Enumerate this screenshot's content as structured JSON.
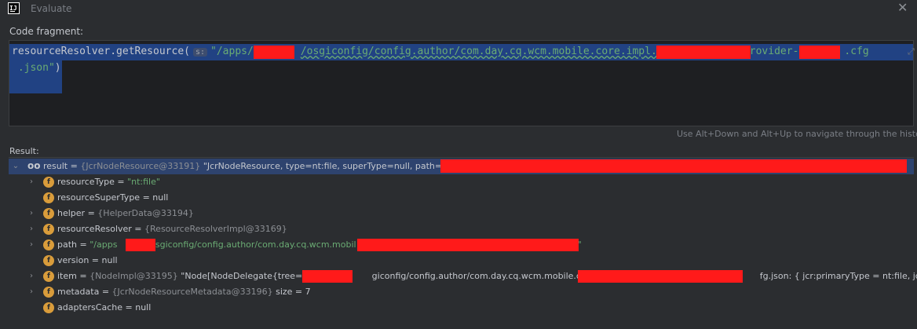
{
  "window": {
    "title": "Evaluate",
    "close_label": "✕",
    "app_icon_text": "IJ"
  },
  "code": {
    "label": "Code fragment:",
    "line1_pre": "resourceResolver.getResource(",
    "param_hint": "s:",
    "line1_str_a": "\"/apps/",
    "line1_str_b": "/osgiconfig/config.author/com.day.cq.wcm.mobile.core.impl.",
    "line1_str_c": "rovider-",
    "line1_str_d": ".cfg",
    "line2_str": " .json\"",
    "line2_post": ")"
  },
  "nav_hint": "Use Alt+Down and Alt+Up to navigate through the history",
  "result": {
    "label": "Result:",
    "root": {
      "name": "result",
      "ref": "{JcrNodeResource@33191}",
      "value": "\"JcrNodeResource, type=nt:file, superType=null, path=/apps"
    },
    "fields": [
      {
        "name": "resourceType",
        "eq": " = ",
        "ref": "",
        "value": "\"nt:file\"",
        "value_is_string": true,
        "expandable": true
      },
      {
        "name": "resourceSuperType",
        "eq": " = ",
        "ref": "",
        "value": "null",
        "value_is_string": false,
        "expandable": false
      },
      {
        "name": "helper",
        "eq": " = ",
        "ref": "{HelperData@33194}",
        "value": "",
        "value_is_string": false,
        "expandable": true
      },
      {
        "name": "resourceResolver",
        "eq": " = ",
        "ref": "{ResourceResolverImpl@33169}",
        "value": "",
        "value_is_string": false,
        "expandable": true
      },
      {
        "name": "path",
        "eq": " = ",
        "ref": "",
        "value": "\"/apps",
        "value_is_string": true,
        "expandable": true,
        "value2": "/osgiconfig/config.author/com.day.cq.wcm.mobil",
        "tail": "\""
      },
      {
        "name": "version",
        "eq": " = ",
        "ref": "",
        "value": "null",
        "value_is_string": false,
        "expandable": false
      },
      {
        "name": "item",
        "eq": " = ",
        "ref": "{NodeImpl@33195}",
        "value": "\"Node[NodeDelegate{tree=/app",
        "value_is_string": false,
        "expandable": true,
        "value2": "giconfig/config.author/com.day.cq.wcm.mobile.core",
        "value3": "fg.json: { jcr:primaryType = nt:file, jcr:crea"
      },
      {
        "name": "metadata",
        "eq": " = ",
        "ref": "{JcrNodeResourceMetadata@33196}",
        "value": " size = 7",
        "value_is_string": false,
        "expandable": true
      },
      {
        "name": "adaptersCache",
        "eq": " = ",
        "ref": "",
        "value": "null",
        "value_is_string": false,
        "expandable": false
      }
    ]
  },
  "icons": {
    "field_letter": "f",
    "expand_arrow": "›",
    "collapse_arrow": "⌄",
    "watch_glyph": "oo",
    "expand_editor": "⤢"
  },
  "colors": {
    "selection": "#214283",
    "redaction": "#ff1a1a",
    "field_icon": "#d99c3b",
    "string": "#6aab73"
  }
}
